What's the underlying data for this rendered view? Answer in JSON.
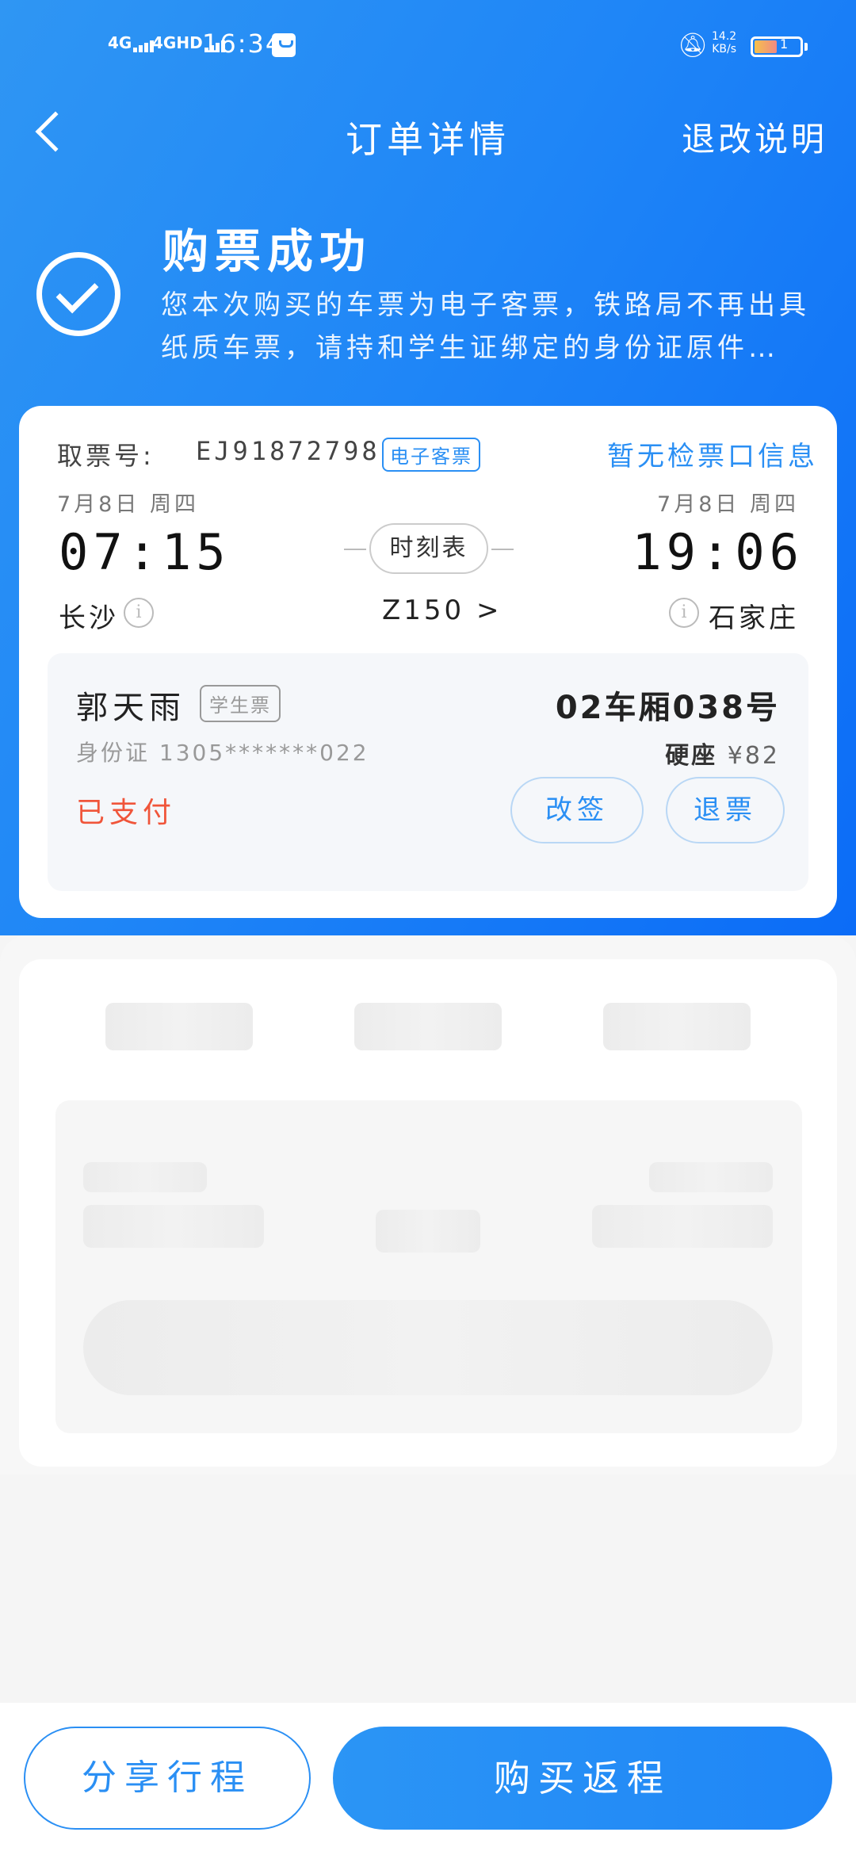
{
  "status_bar": {
    "signal1": "4G",
    "signal2": "4GHD",
    "time": "16:34",
    "net_speed": "14.2",
    "net_unit": "KB/s",
    "battery_level": "1"
  },
  "nav": {
    "title": "订单详情",
    "rules_link": "退改说明"
  },
  "success": {
    "heading": "购票成功",
    "description": "您本次购买的车票为电子客票，铁路局不再出具纸质车票，请持和学生证绑定的身份证原件…"
  },
  "ticket": {
    "pickup_label": "取票号:",
    "pickup_number": "EJ91872798",
    "e_ticket_tag": "电子客票",
    "gate_info": "暂无检票口信息",
    "depart_date": "7月8日  周四",
    "arrive_date": "7月8日  周四",
    "depart_time": "07:15",
    "arrive_time": "19:06",
    "schedule_button": "时刻表",
    "depart_station": "长沙",
    "arrive_station": "石家庄",
    "train_no": "Z150 >",
    "passenger": {
      "name": "郭天雨",
      "ticket_type": "学生票",
      "seat": "02车厢038号",
      "id_label": "身份证  1305*******022",
      "seat_class": "硬座",
      "price": "¥82",
      "pay_status": "已支付",
      "change_button": "改签",
      "refund_button": "退票"
    }
  },
  "bottom": {
    "share_button": "分享行程",
    "return_button": "购买返程"
  },
  "colors": {
    "accent": "#2a8ff4",
    "paid": "#f0553a"
  }
}
